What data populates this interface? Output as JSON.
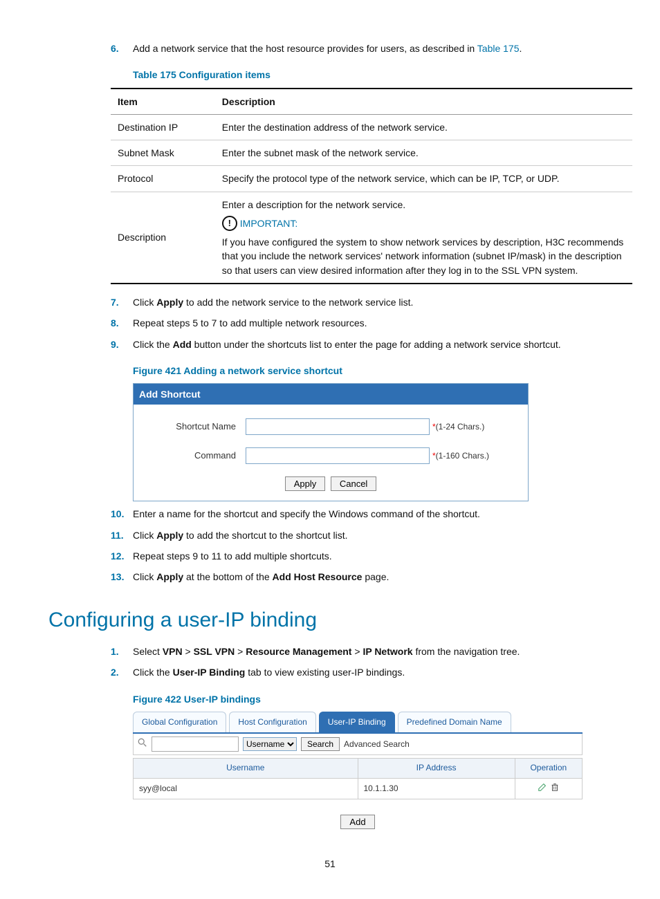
{
  "page_number": "51",
  "steps_a": {
    "s6": {
      "num": "6.",
      "pre": "Add a network service that the host resource provides for users, as described in ",
      "link": "Table 175",
      "post": "."
    },
    "s7": {
      "num": "7.",
      "pre": "Click ",
      "b": "Apply",
      "post": " to add the network service to the network service list."
    },
    "s8": {
      "num": "8.",
      "text": "Repeat steps 5 to 7 to add multiple network resources."
    },
    "s9": {
      "num": "9.",
      "pre": "Click the ",
      "b": "Add",
      "post": " button under the shortcuts list to enter the page for adding a network service shortcut."
    }
  },
  "steps_b": {
    "s10": {
      "num": "10.",
      "text": "Enter a name for the shortcut and specify the Windows command of the shortcut."
    },
    "s11": {
      "num": "11.",
      "pre": "Click ",
      "b": "Apply",
      "post": " to add the shortcut to the shortcut list."
    },
    "s12": {
      "num": "12.",
      "text": "Repeat steps 9 to 11 to add multiple shortcuts."
    },
    "s13": {
      "num": "13.",
      "pre": "Click ",
      "b1": "Apply",
      "mid": " at the bottom of the ",
      "b2": "Add Host Resource",
      "post": " page."
    }
  },
  "caption175": "Table 175 Configuration items",
  "caption421": "Figure 421 Adding a network service shortcut",
  "caption422": "Figure 422 User-IP bindings",
  "table175": {
    "h1": "Item",
    "h2": "Description",
    "rows": {
      "r1": {
        "c1": "Destination IP",
        "c2": "Enter the destination address of the network service."
      },
      "r2": {
        "c1": "Subnet Mask",
        "c2": "Enter the subnet mask of the network service."
      },
      "r3": {
        "c1": "Protocol",
        "c2": "Specify the protocol type of the network service, which can be IP, TCP, or UDP."
      },
      "r4": {
        "c1": "Description",
        "desc_intro": "Enter a description for the network service.",
        "important_label": "IMPORTANT:",
        "important_text": "If you have configured the system to show network services by description, H3C recommends that you include the network services' network information (subnet IP/mask) in the description so that users can view desired information after they log in to the SSL VPN system."
      }
    }
  },
  "shortcut_panel": {
    "title": "Add Shortcut",
    "name_label": "Shortcut Name",
    "name_hint_star": "*",
    "name_hint": "(1-24 Chars.)",
    "cmd_label": "Command",
    "cmd_hint_star": "*",
    "cmd_hint": "(1-160 Chars.)",
    "apply": "Apply",
    "cancel": "Cancel"
  },
  "section_heading": "Configuring a user-IP binding",
  "steps_c": {
    "s1": {
      "num": "1.",
      "pre": "Select ",
      "b1": "VPN",
      "gt1": " > ",
      "b2": "SSL VPN",
      "gt2": " > ",
      "b3": "Resource Management",
      "gt3": " > ",
      "b4": "IP Network",
      "post": " from the navigation tree."
    },
    "s2": {
      "num": "2.",
      "pre": "Click the ",
      "b": "User-IP Binding",
      "post": " tab to view existing user-IP bindings."
    }
  },
  "ui_panel": {
    "tabs": {
      "t1": "Global Configuration",
      "t2": "Host Configuration",
      "t3": "User-IP Binding",
      "t4": "Predefined Domain Name"
    },
    "select_value": "Username",
    "search_btn": "Search",
    "adv_search": "Advanced Search",
    "headers": {
      "h1": "Username",
      "h2": "IP Address",
      "h3": "Operation"
    },
    "row": {
      "user": "syy@local",
      "ip": "10.1.1.30"
    },
    "add_btn": "Add"
  }
}
